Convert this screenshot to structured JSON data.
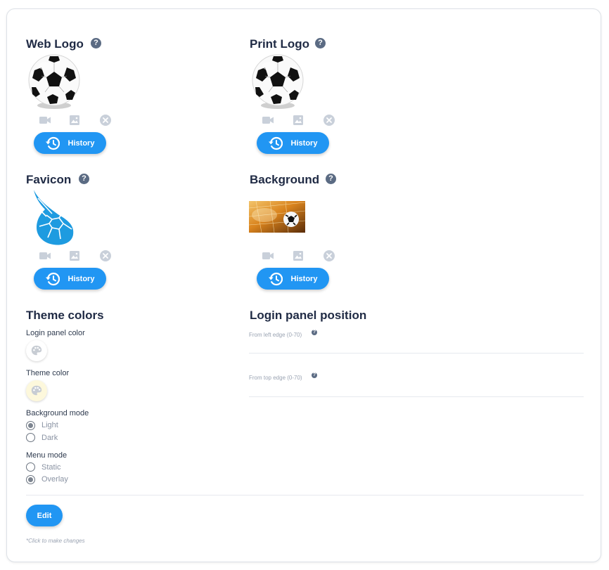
{
  "web_logo": {
    "title": "Web Logo",
    "history_label": "History"
  },
  "print_logo": {
    "title": "Print Logo",
    "history_label": "History"
  },
  "favicon": {
    "title": "Favicon",
    "history_label": "History"
  },
  "background": {
    "title": "Background",
    "history_label": "History"
  },
  "theme": {
    "title": "Theme colors",
    "login_panel_color_label": "Login panel color",
    "login_panel_color": "#ffffff",
    "theme_color_label": "Theme color",
    "theme_color": "#fdf8dc",
    "background_mode_label": "Background mode",
    "background_mode_options": [
      "Light",
      "Dark"
    ],
    "background_mode_selected": "Light",
    "menu_mode_label": "Menu mode",
    "menu_mode_options": [
      "Static",
      "Overlay"
    ],
    "menu_mode_selected": "Overlay"
  },
  "login_position": {
    "title": "Login panel position",
    "left_label": "From left edge (0-70)",
    "left_value": "",
    "top_label": "From top edge (0-70)",
    "top_value": ""
  },
  "actions": {
    "edit_label": "Edit",
    "hint": "*Click to make changes"
  },
  "colors": {
    "accent": "#2196f3",
    "muted_icon": "#c9d0da",
    "help_icon": "#5b6b83"
  },
  "icons": {
    "help": "help-circle-icon",
    "video": "video-icon",
    "image": "image-icon",
    "remove": "close-circle-icon",
    "history": "history-icon",
    "palette": "palette-icon"
  }
}
